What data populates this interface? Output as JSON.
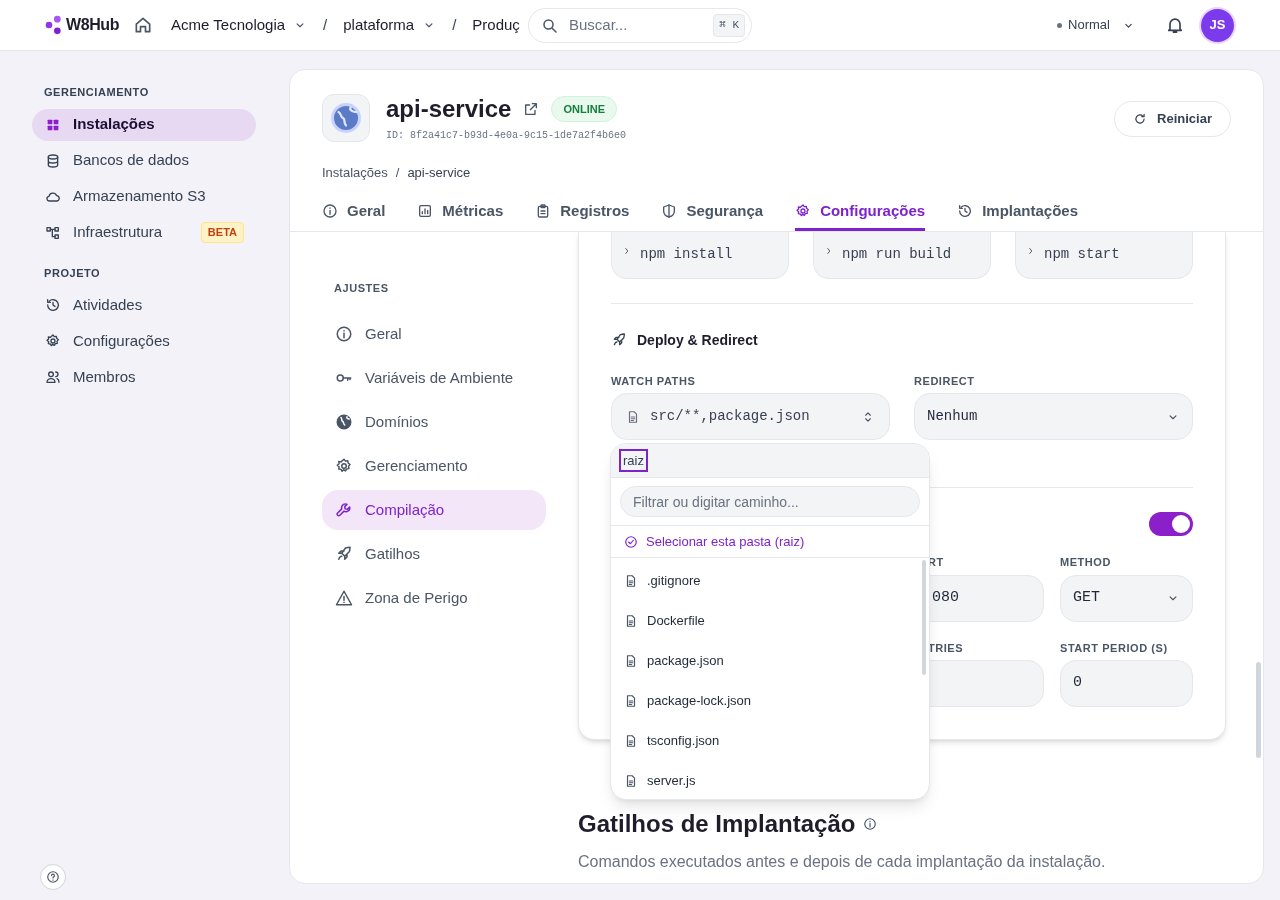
{
  "topbar": {
    "logo": "W8Hub",
    "breadcrumbs": [
      {
        "label": "Acme Tecnologia",
        "dropdown": true
      },
      {
        "label": "plataforma",
        "dropdown": true,
        "separator": "/"
      },
      {
        "label": "Produç",
        "dropdown": false,
        "separator": "/"
      }
    ],
    "search": {
      "placeholder": "Buscar...",
      "shortcut": "⌘ K"
    },
    "mode": "Normal",
    "avatar": "JS"
  },
  "sidebar": {
    "sections": [
      {
        "title": "GERENCIAMENTO",
        "items": [
          {
            "label": "Instalações",
            "kind": "grid",
            "selected": true
          },
          {
            "label": "Bancos de dados",
            "kind": "database",
            "selected": false
          },
          {
            "label": "Armazenamento S3",
            "kind": "cloud",
            "selected": false
          },
          {
            "label": "Infraestrutura",
            "kind": "network",
            "selected": false,
            "badge": "BETA"
          }
        ]
      },
      {
        "title": "PROJETO",
        "items": [
          {
            "label": "Atividades",
            "kind": "history",
            "selected": false
          },
          {
            "label": "Configurações",
            "kind": "gear",
            "selected": false
          },
          {
            "label": "Membros",
            "kind": "users",
            "selected": false
          }
        ]
      }
    ]
  },
  "app": {
    "name": "api-service",
    "status": "ONLINE",
    "id": "ID: 8f2a41c7-b93d-4e0a-9c15-1de7a2f4b6e0",
    "restart": "Reiniciar",
    "breadcrumb": [
      {
        "label": "Instalações"
      },
      {
        "label": "api-service",
        "separator": "/"
      }
    ],
    "tabs": [
      {
        "label": "Geral",
        "kind": "info",
        "selected": false
      },
      {
        "label": "Métricas",
        "kind": "chart",
        "selected": false
      },
      {
        "label": "Registros",
        "kind": "clipboard",
        "selected": false
      },
      {
        "label": "Segurança",
        "kind": "shield",
        "selected": false
      },
      {
        "label": "Configurações",
        "kind": "gear",
        "selected": true
      },
      {
        "label": "Implantações",
        "kind": "history",
        "selected": false
      }
    ]
  },
  "settings_nav": {
    "title": "AJUSTES",
    "items": [
      {
        "label": "Geral",
        "kind": "info",
        "selected": false
      },
      {
        "label": "Variáveis de Ambiente",
        "kind": "key",
        "selected": false
      },
      {
        "label": "Domínios",
        "kind": "globe",
        "selected": false
      },
      {
        "label": "Gerenciamento",
        "kind": "gear",
        "selected": false
      },
      {
        "label": "Compilação",
        "kind": "wrench",
        "selected": true
      },
      {
        "label": "Gatilhos",
        "kind": "rocket",
        "selected": false
      },
      {
        "label": "Zona de Perigo",
        "kind": "warning",
        "selected": false
      }
    ]
  },
  "build": {
    "commands": [
      "npm install",
      "npm run build",
      "npm start"
    ],
    "deploy_title": "Deploy & Redirect",
    "watch_paths": {
      "label": "WATCH PATHS",
      "value": "src/**,package.json"
    },
    "redirect": {
      "label": "REDIRECT",
      "value": "Nenhum"
    },
    "healthcheck_on": true,
    "fields": [
      {
        "label": "RT",
        "value": "080",
        "kind": "input"
      },
      {
        "label": "METHOD",
        "value": "GET",
        "kind": "select"
      },
      {
        "label": "TRIES",
        "kind": "input"
      },
      {
        "label": "START PERIOD (S)",
        "value": "0",
        "kind": "input"
      }
    ]
  },
  "dropdown": {
    "path": "raiz",
    "filter_placeholder": "Filtrar ou digitar caminho...",
    "select_option": "Selecionar esta pasta (raiz)",
    "files": [
      ".gitignore",
      "Dockerfile",
      "package.json",
      "package-lock.json",
      "tsconfig.json",
      "server.js"
    ]
  },
  "triggers": {
    "title": "Gatilhos de Implantação",
    "description": "Comandos executados antes e depois de cada implantação da instalação."
  }
}
